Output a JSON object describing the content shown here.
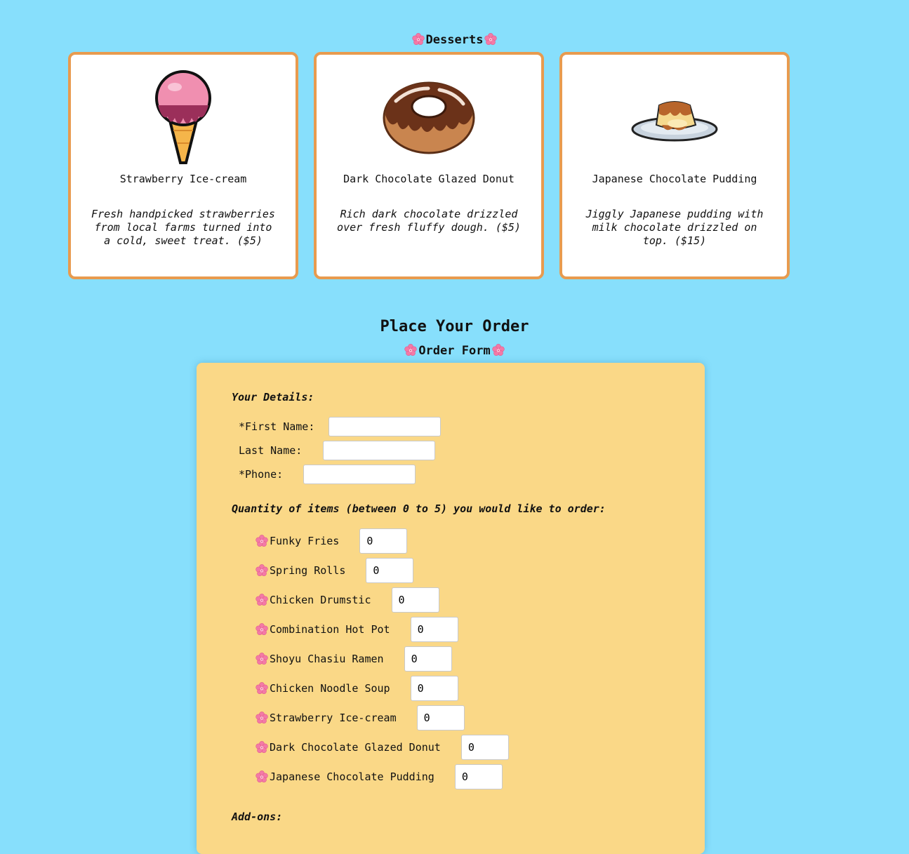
{
  "desserts": {
    "title": "Desserts",
    "items": [
      {
        "name": "Strawberry Ice-cream",
        "description": "Fresh handpicked strawberries from local farms turned into a cold, sweet treat. ($5)"
      },
      {
        "name": "Dark Chocolate Glazed Donut",
        "description": "Rich dark chocolate drizzled over fresh fluffy dough. ($5)"
      },
      {
        "name": "Japanese Chocolate Pudding",
        "description": "Jiggly Japanese pudding with milk chocolate drizzled on top. ($15)"
      }
    ]
  },
  "order": {
    "title": "Place Your Order",
    "form_title": "Order Form",
    "details_heading": "Your Details:",
    "fields": {
      "first_name": {
        "label": "*First Name:",
        "value": ""
      },
      "last_name": {
        "label": "Last Name:",
        "value": ""
      },
      "phone": {
        "label": "*Phone:",
        "value": ""
      }
    },
    "quantity_heading": "Quantity of items (between 0 to 5) you would like to order:",
    "quantities": [
      {
        "label": "Funky Fries",
        "value": "0"
      },
      {
        "label": "Spring Rolls",
        "value": "0"
      },
      {
        "label": "Chicken Drumstic",
        "value": "0"
      },
      {
        "label": "Combination Hot Pot",
        "value": "0"
      },
      {
        "label": "Shoyu Chasiu Ramen",
        "value": "0"
      },
      {
        "label": "Chicken Noodle Soup",
        "value": "0"
      },
      {
        "label": "Strawberry Ice-cream",
        "value": "0"
      },
      {
        "label": "Dark Chocolate Glazed Donut",
        "value": "0"
      },
      {
        "label": "Japanese Chocolate Pudding",
        "value": "0"
      }
    ],
    "addons_heading": "Add-ons:"
  },
  "colors": {
    "background": "#87dffc",
    "card_border": "#e89b4f",
    "form_background": "#fad887",
    "flower": "#f06a9a"
  },
  "icons": {
    "flower": "cherry-blossom-icon",
    "ice_cream": "ice-cream-icon",
    "donut": "donut-icon",
    "pudding": "pudding-icon"
  }
}
